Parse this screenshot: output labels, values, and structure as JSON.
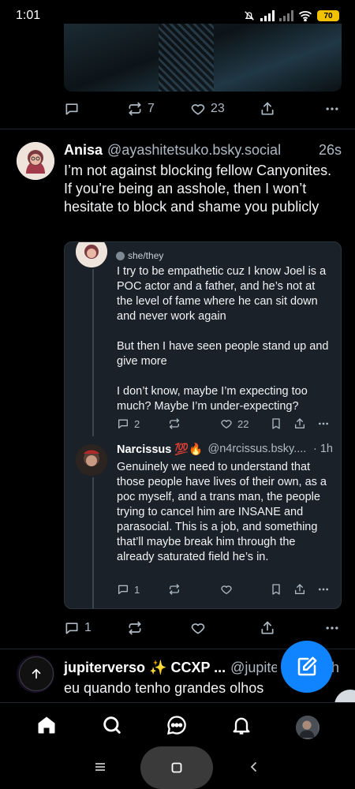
{
  "status_bar": {
    "time": "1:01",
    "battery": "70"
  },
  "previous_post": {
    "actions": {
      "reply_count": "",
      "repost_count": "7",
      "like_count": "23"
    }
  },
  "main_post": {
    "author_name": "Anisa",
    "author_handle": "@ayashitetsuko.bsky.social",
    "time": "26s",
    "text": "I’m not against blocking fellow Canyonites. If you’re being an asshole, then I won’t hesitate to block and shame you publicly",
    "actions": {
      "reply_count": "1",
      "repost_count": "",
      "like_count": ""
    }
  },
  "embed": {
    "pronouns": "she/they",
    "post_text": "I try to be empathetic cuz I know Joel is a POC actor and a father, and he’s not at the level of fame where he can sit down and never work again\n\nBut then I have seen people stand up and give more\n\nI don’t know, maybe I’m expecting too much? Maybe I’m under-expecting?",
    "post_actions": {
      "reply_count": "2",
      "like_count": "22"
    },
    "reply_author_name": "Narcissus 💯🔥",
    "reply_author_handle": "@n4rcissus.bsky....",
    "reply_time": "· 1h",
    "reply_text": "Genuinely we need to understand that those people have lives of their own, as a poc myself, and a trans man, the people trying to cancel him are INSANE and parasocial. This is a job, and something that’ll maybe break him through the already saturated field he’s in.",
    "reply_actions": {
      "reply_count": "1"
    }
  },
  "next_post": {
    "author_name": "jupiterverso ✨ CCXP ...",
    "author_handle": "@jupite",
    "time": "h",
    "text": "eu quando tenho grandes olhos"
  },
  "bottom_nav": {
    "items": [
      "home-icon",
      "search-icon",
      "chat-icon",
      "bell-icon",
      "profile-avatar"
    ]
  },
  "colors": {
    "accent": "#1083fe",
    "muted": "#aeb9c4",
    "background": "#000000",
    "embed_bg": "#1a2128"
  }
}
